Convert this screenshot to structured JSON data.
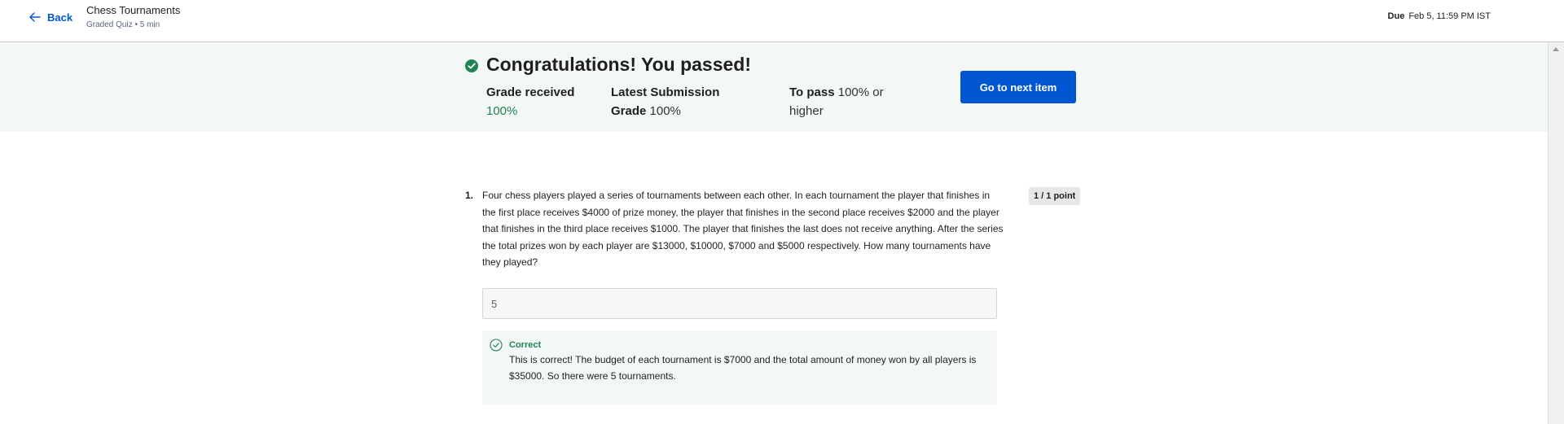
{
  "header": {
    "back_label": "Back",
    "title": "Chess Tournaments",
    "meta": "Graded Quiz • 5 min",
    "due_label": "Due",
    "due_value": "Feb 5, 11:59 PM IST"
  },
  "banner": {
    "title": "Congratulations! You passed!",
    "grade_label": "Grade received",
    "grade_value": "100%",
    "latest_label": "Latest Submission Grade",
    "latest_value": "100%",
    "topass_label": "To pass",
    "topass_value": "100% or higher",
    "next_button": "Go to next item"
  },
  "question": {
    "number": "1.",
    "text": "Four chess players played a series of tournaments between each other. In each tournament the player that finishes in the first place receives $4000 of prize money, the player that finishes in the second place receives $2000 and the player that finishes in the third place receives $1000. The player that finishes the last does not receive anything. After the series the total prizes won by each player are $13000, $10000, $7000 and $5000 respectively. How many tournaments have they played?",
    "points": "1 / 1 point",
    "answer": "5",
    "feedback_title": "Correct",
    "feedback_text": "This is correct! The budget of each tournament is $7000 and the total amount of money won by all players is $35000. So there were 5 tournaments."
  },
  "colors": {
    "accent": "#0056d2",
    "success": "#1f8354",
    "banner_bg": "#f3f8f6"
  },
  "icons": {
    "back": "arrow-left-icon",
    "passed": "check-circle-filled-icon",
    "correct": "check-circle-outline-icon"
  }
}
